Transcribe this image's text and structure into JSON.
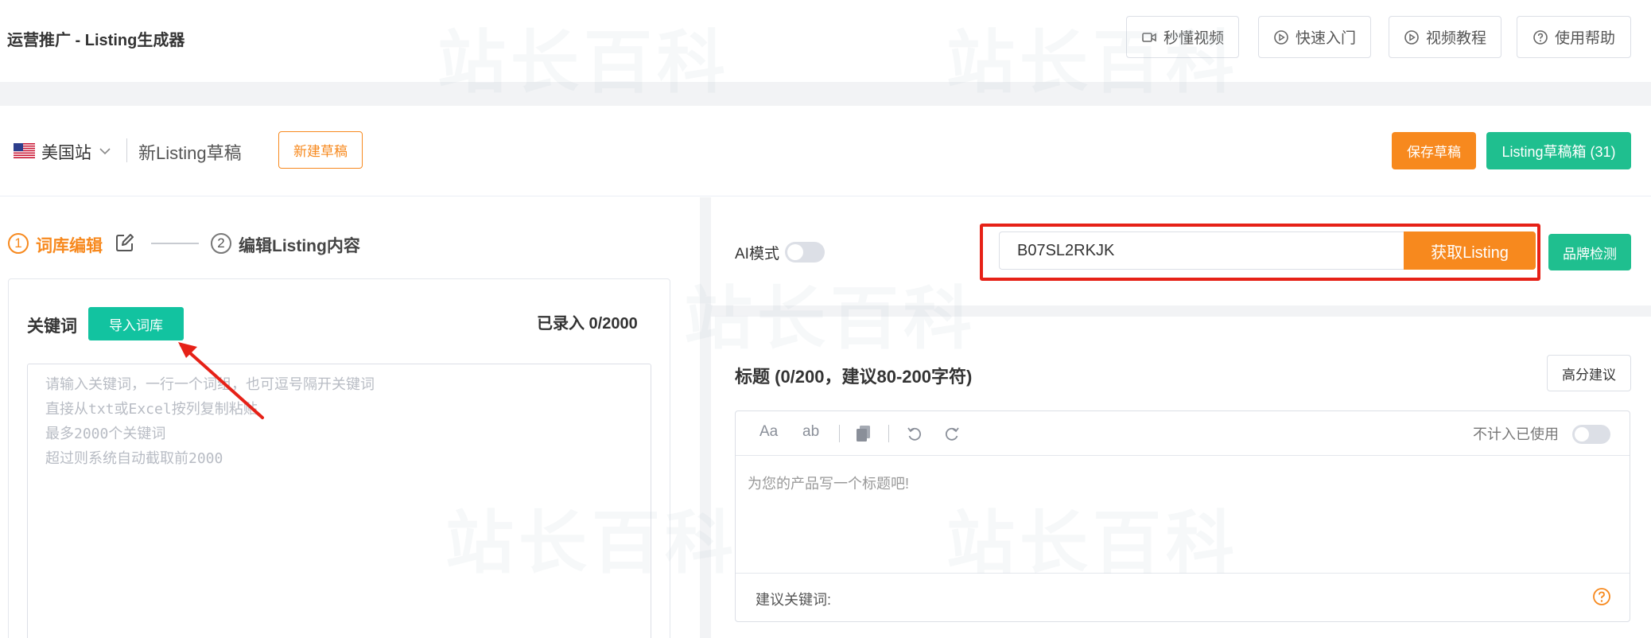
{
  "header": {
    "title": "运营推广 - Listing生成器",
    "help_buttons": [
      {
        "label": "秒懂视频",
        "icon": "video-camera-icon"
      },
      {
        "label": "快速入门",
        "icon": "play-circle-icon"
      },
      {
        "label": "视频教程",
        "icon": "play-circle-icon"
      },
      {
        "label": "使用帮助",
        "icon": "question-circle-icon"
      }
    ]
  },
  "toolbar": {
    "site": "美国站",
    "site_flag": "us-flag-icon",
    "draft_name": "新Listing草稿",
    "new_draft": "新建草稿",
    "save_draft": "保存草稿",
    "draft_box": "Listing草稿箱 (31)"
  },
  "steps": [
    {
      "number": "1",
      "label": "词库编辑",
      "active": true
    },
    {
      "number": "2",
      "label": "编辑Listing内容",
      "active": false
    }
  ],
  "keywords": {
    "label": "关键词",
    "import_button": "导入词库",
    "count": "已录入 0/2000",
    "placeholder_lines": [
      "请输入关键词，一行一个词组，也可逗号隔开关键词",
      "直接从txt或Excel按列复制粘贴",
      "最多2000个关键词",
      "超过则系统自动截取前2000"
    ]
  },
  "right": {
    "ai_mode_label": "AI模式",
    "asin_value": "B07SL2RKJK",
    "fetch_button": "获取Listing",
    "brand_button": "品牌检测",
    "title_heading": "标题 (0/200，建议80-200字符)",
    "high_score_button": "高分建议",
    "editor_tools": [
      "Aa",
      "ab"
    ],
    "not_count_label": "不计入已使用",
    "title_placeholder": "为您的产品写一个标题吧!",
    "suggest_label": "建议关键词:"
  },
  "watermark": "站长百科",
  "colors": {
    "accent_orange": "#f7891e",
    "accent_green": "#1fbf8f",
    "teal": "#12c3a0",
    "annotation_red": "#e62117"
  }
}
